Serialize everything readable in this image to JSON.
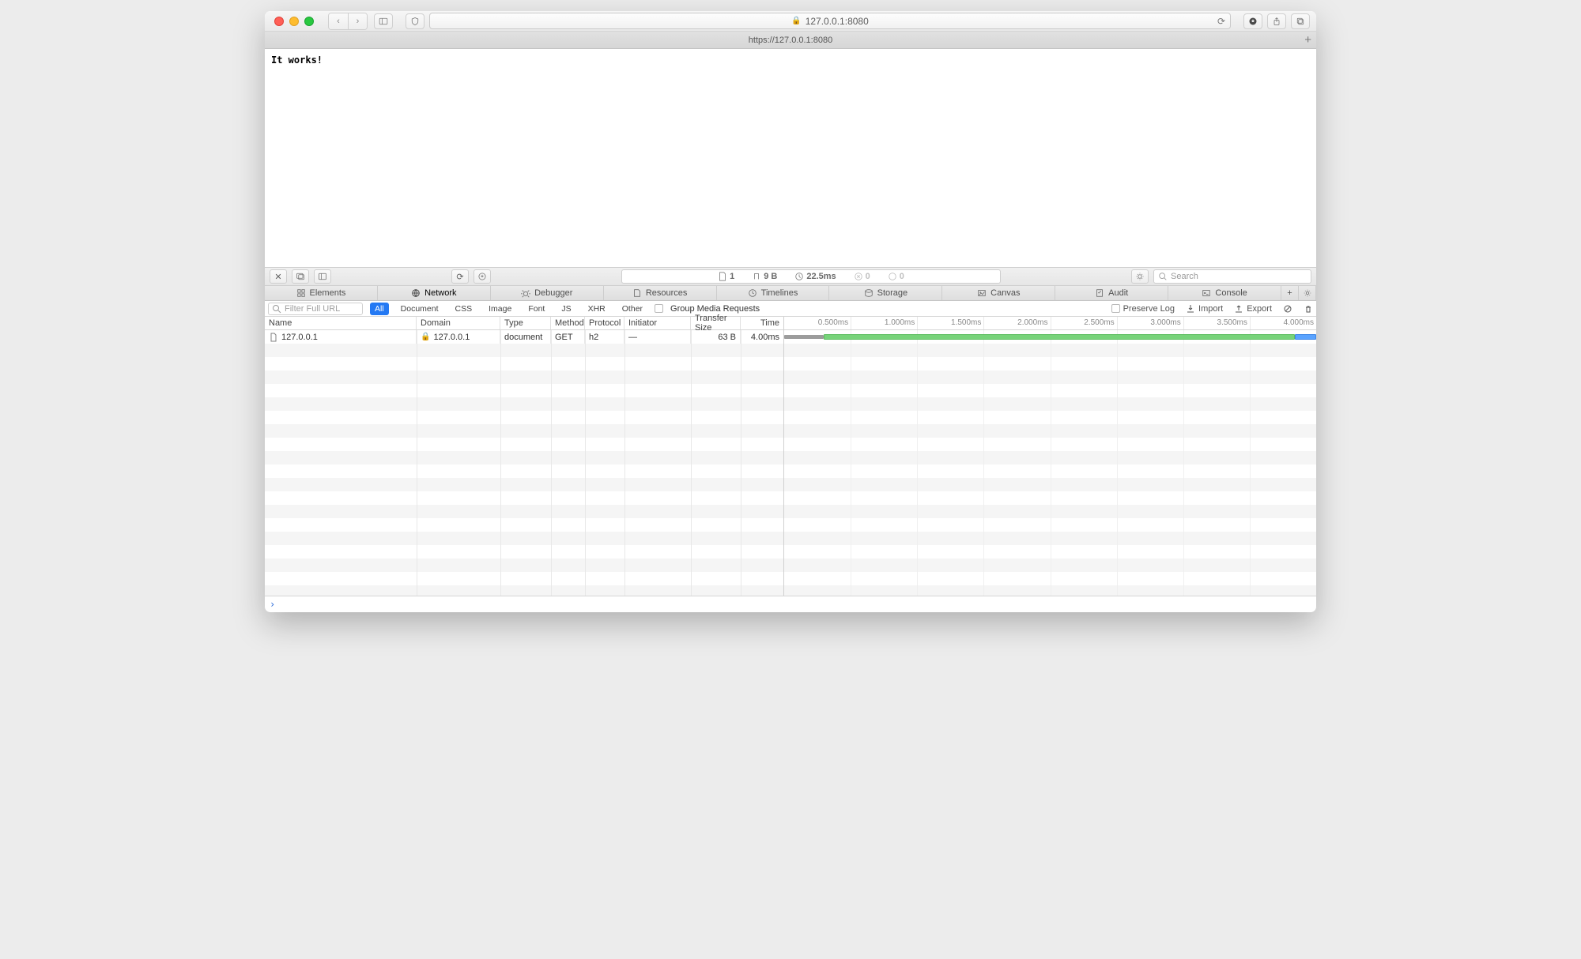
{
  "address": {
    "display": "127.0.0.1:8080",
    "tab_title": "https://127.0.0.1:8080"
  },
  "page": {
    "content": "It works!"
  },
  "devtools": {
    "stats": {
      "docs": "1",
      "size": "9 B",
      "time": "22.5ms",
      "err1": "0",
      "err2": "0"
    },
    "search_placeholder": "Search",
    "tabs": [
      "Elements",
      "Network",
      "Debugger",
      "Resources",
      "Timelines",
      "Storage",
      "Canvas",
      "Audit",
      "Console"
    ],
    "active_tab": "Network"
  },
  "network": {
    "filter_placeholder": "Filter Full URL",
    "type_filters": [
      "All",
      "Document",
      "CSS",
      "Image",
      "Font",
      "JS",
      "XHR",
      "Other"
    ],
    "active_type": "All",
    "group_media": "Group Media Requests",
    "preserve_log": "Preserve Log",
    "import": "Import",
    "export": "Export",
    "columns": [
      "Name",
      "Domain",
      "Type",
      "Method",
      "Protocol",
      "Initiator",
      "Transfer Size",
      "Time"
    ],
    "rows": [
      {
        "name": "127.0.0.1",
        "domain": "127.0.0.1",
        "type": "document",
        "method": "GET",
        "protocol": "h2",
        "initiator": "—",
        "size": "63 B",
        "time": "4.00ms"
      }
    ],
    "timeline": {
      "ticks": [
        "0.500ms",
        "1.000ms",
        "1.500ms",
        "2.000ms",
        "2.500ms",
        "3.000ms",
        "3.500ms",
        "4.000ms"
      ],
      "rows": [
        {
          "grey_start": 0,
          "grey_end": 7.5,
          "green_start": 7.5,
          "green_end": 96,
          "blue_start": 96,
          "blue_end": 100
        }
      ]
    }
  },
  "console": {
    "prompt": "›"
  }
}
